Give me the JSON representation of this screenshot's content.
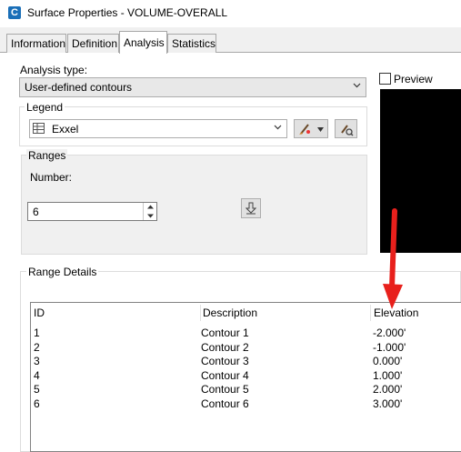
{
  "window": {
    "title": "Surface Properties - VOLUME-OVERALL",
    "app_icon_letter": "C"
  },
  "tabs": [
    {
      "label": "Information",
      "active": false
    },
    {
      "label": "Definition",
      "active": false
    },
    {
      "label": "Analysis",
      "active": true
    },
    {
      "label": "Statistics",
      "active": false
    }
  ],
  "analysis": {
    "label": "Analysis type:",
    "selected": "User-defined contours"
  },
  "legend": {
    "title": "Legend",
    "selected": "Exxel"
  },
  "ranges": {
    "title": "Ranges",
    "number_label": "Number:",
    "number_value": "6"
  },
  "preview": {
    "label": "Preview",
    "checked": false
  },
  "range_details": {
    "title": "Range Details",
    "columns": [
      "ID",
      "Description",
      "Elevation"
    ],
    "rows": [
      [
        "1",
        "Contour 1",
        "-2.000'"
      ],
      [
        "2",
        "Contour 2",
        "-1.000'"
      ],
      [
        "3",
        "Contour 3",
        "0.000'"
      ],
      [
        "4",
        "Contour 4",
        "1.000'"
      ],
      [
        "5",
        "Contour 5",
        "2.000'"
      ],
      [
        "6",
        "Contour 6",
        "3.000'"
      ]
    ]
  },
  "annotation": {
    "arrow_color": "#e8201c"
  },
  "colors": {
    "accent": "#1a6fb8",
    "preview_bg": "#000000"
  }
}
